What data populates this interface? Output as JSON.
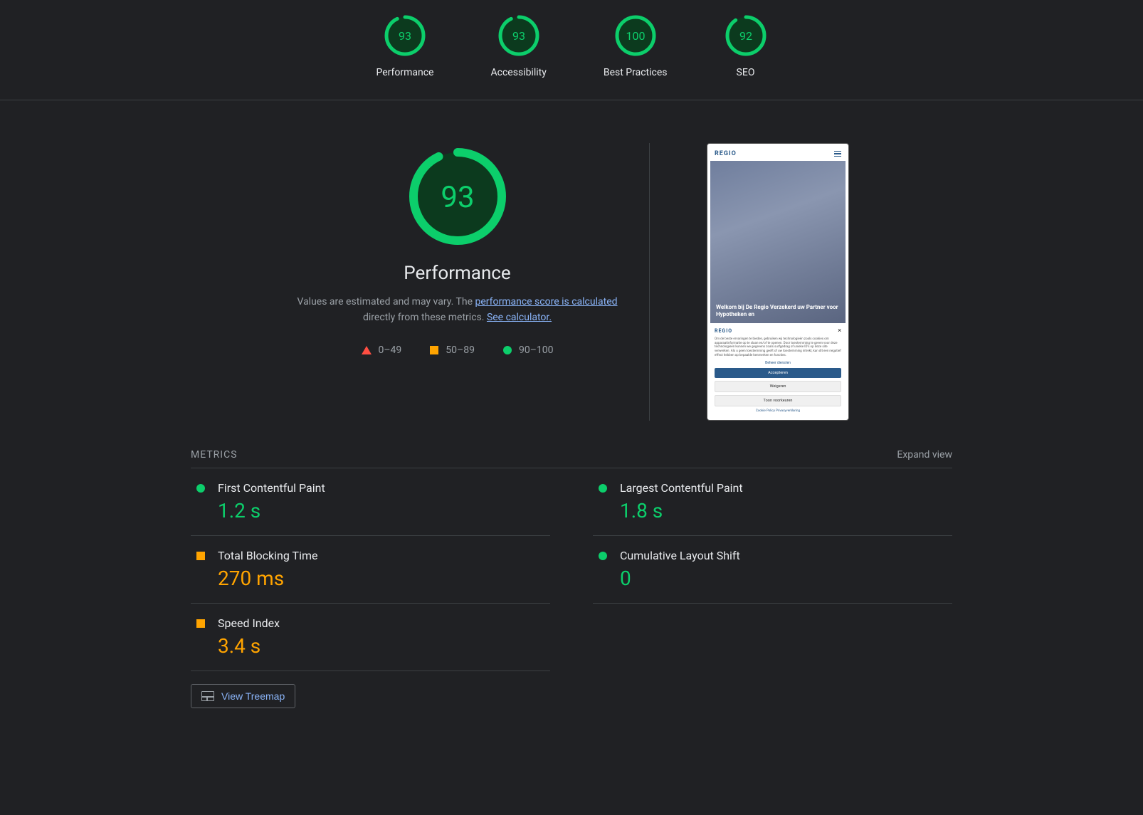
{
  "gauges": [
    {
      "score": 93,
      "label": "Performance"
    },
    {
      "score": 93,
      "label": "Accessibility"
    },
    {
      "score": 100,
      "label": "Best Practices"
    },
    {
      "score": 92,
      "label": "SEO"
    }
  ],
  "big_gauge": {
    "score": 93,
    "title": "Performance"
  },
  "description": {
    "prefix": "Values are estimated and may vary. The ",
    "link1": "performance score is calculated",
    "mid": " directly from these metrics. ",
    "link2": "See calculator."
  },
  "legend": [
    {
      "shape": "triangle",
      "label": "0–49"
    },
    {
      "shape": "square",
      "label": "50–89"
    },
    {
      "shape": "circle",
      "label": "90–100"
    }
  ],
  "screenshot": {
    "logo": "REGIO",
    "hero": "Welkom bij De Regio Verzekerd uw Partner voor Hypotheken en",
    "cookie_logo": "REGIO",
    "cookie_close": "×",
    "cookie_text": "Om de beste ervaringen te bieden, gebruiken wij technologieën zoals cookies om apparaatinformatie op te slaan en/of te openen. Door toestemming te geven voor deze technologieën kunnen we gegevens zoals surfgedrag of unieke ID's op deze site verwerken. Als u geen toestemming geeft of uw toestemming intrekt, kan dit een negatief effect hebben op bepaalde kenmerken en functies.",
    "cookie_manage": "Beheer diensten",
    "cookie_accept": "Accepteren",
    "cookie_deny": "Weigeren",
    "cookie_prefs": "Toon voorkeuren",
    "cookie_footer": "Cookie Policy   Privacyverklaring"
  },
  "metrics_header": {
    "title": "METRICS",
    "expand": "Expand view"
  },
  "metrics": [
    {
      "name": "First Contentful Paint",
      "value": "1.2 s",
      "status": "good"
    },
    {
      "name": "Largest Contentful Paint",
      "value": "1.8 s",
      "status": "good"
    },
    {
      "name": "Total Blocking Time",
      "value": "270 ms",
      "status": "avg"
    },
    {
      "name": "Cumulative Layout Shift",
      "value": "0",
      "status": "good"
    },
    {
      "name": "Speed Index",
      "value": "3.4 s",
      "status": "avg"
    }
  ],
  "treemap_label": "View Treemap",
  "colors": {
    "good": "#0cce6b",
    "avg": "#ffa400",
    "fail": "#ff4e42",
    "link": "#8ab4f8"
  }
}
